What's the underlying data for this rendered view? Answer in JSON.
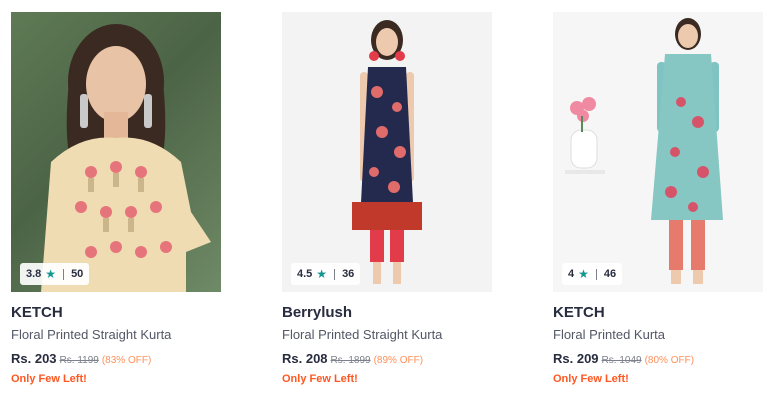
{
  "products": [
    {
      "brand": "KETCH",
      "name": "Floral Printed Straight Kurta",
      "rating": "3.8",
      "rating_count": "50",
      "price": "Rs. 203",
      "mrp": "Rs. 1199",
      "discount": "(83% OFF)",
      "stock_note": "Only Few Left!",
      "image_label": "product-photo"
    },
    {
      "brand": "Berrylush",
      "name": "Floral Printed Straight Kurta",
      "rating": "4.5",
      "rating_count": "36",
      "price": "Rs. 208",
      "mrp": "Rs. 1899",
      "discount": "(89% OFF)",
      "stock_note": "Only Few Left!",
      "image_label": "product-photo"
    },
    {
      "brand": "KETCH",
      "name": "Floral Printed Kurta",
      "rating": "4",
      "rating_count": "46",
      "price": "Rs. 209",
      "mrp": "Rs. 1049",
      "discount": "(80% OFF)",
      "stock_note": "Only Few Left!",
      "image_label": "product-photo"
    }
  ],
  "icons": {
    "rating": "star-icon"
  },
  "colors": {
    "star": "#14958f",
    "discount": "#ff905a",
    "stock_note": "#ff5722",
    "text_primary": "#282c3f",
    "text_secondary": "#535766"
  }
}
